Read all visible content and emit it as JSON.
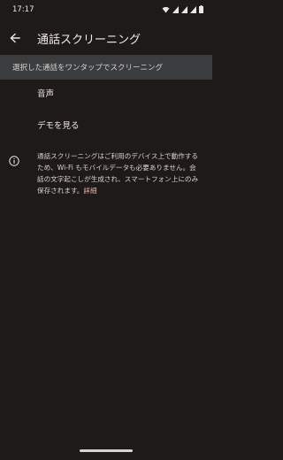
{
  "status_bar": {
    "time": "17:17",
    "icons": [
      "wifi-icon",
      "signal-icon",
      "signal-icon",
      "signal-icon",
      "battery-icon"
    ]
  },
  "app_bar": {
    "back_icon": "arrow-back-icon",
    "title": "通話スクリーニング"
  },
  "section": {
    "header": "選択した通話をワンタップでスクリーニング"
  },
  "items": [
    {
      "label": "音声"
    },
    {
      "label": "デモを見る"
    }
  ],
  "info": {
    "icon": "info-icon",
    "text": "通話スクリーニングはご利用のデバイス上で動作するため、Wi-Fi もモバイルデータも必要ありません。会話の文字起こしが生成され、スマートフォン上にのみ保存されます。",
    "link": "詳細"
  },
  "colors": {
    "background": "#1f1a1a",
    "section_header": "#3a3c3e",
    "link": "#f0b3a4"
  }
}
